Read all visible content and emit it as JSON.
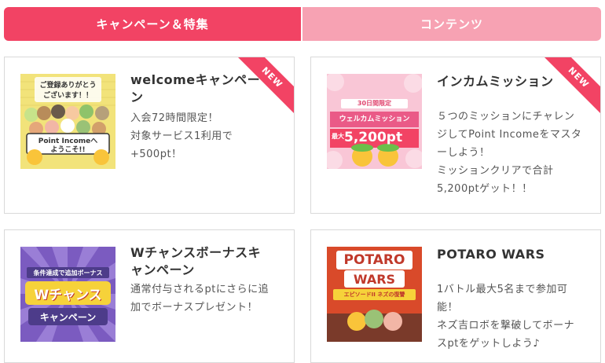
{
  "tabs": {
    "campaign": "キャンペーン＆特集",
    "contents": "コンテンツ"
  },
  "colors": {
    "accent": "#f24364",
    "accent_light": "#f7a2b3"
  },
  "cards": [
    {
      "title": "welcomeキャンペーン",
      "badge": "NEW",
      "description": "入会72時間限定！\n対象サービス1利用で+500pt！",
      "thumbnail": {
        "line1": "ご登録ありがとう",
        "line2": "ございます！！",
        "label": "Point Incomeへ",
        "label2": "ようこそ!!"
      }
    },
    {
      "title": "インカムミッション",
      "badge": "NEW",
      "description": "５つのミッションにチャレンジしてPoint Incomeをマスターしよう！\nミッションクリアで合計5,200ptゲット！！",
      "thumbnail": {
        "ribbon": "30日間限定",
        "headline": "ウェルカムミッション",
        "max_label": "最大",
        "amount": "5,200pt"
      }
    },
    {
      "title": "Wチャンスボーナスキャンペーン",
      "description": "通常付与されるptにさらに追加でボーナスプレゼント！",
      "thumbnail": {
        "top": "条件達成で追加ボーナス",
        "main": "Wチャンス",
        "sub": "キャンペーン"
      }
    },
    {
      "title": "POTARO WARS",
      "description": "1バトル最大5名まで参加可能！\nネズ吉ロボを撃破してボーナスptをゲットしよう♪",
      "thumbnail": {
        "line1": "POTARO",
        "line2": "WARS",
        "sub": "エピソードII ネズの復讐"
      }
    }
  ]
}
